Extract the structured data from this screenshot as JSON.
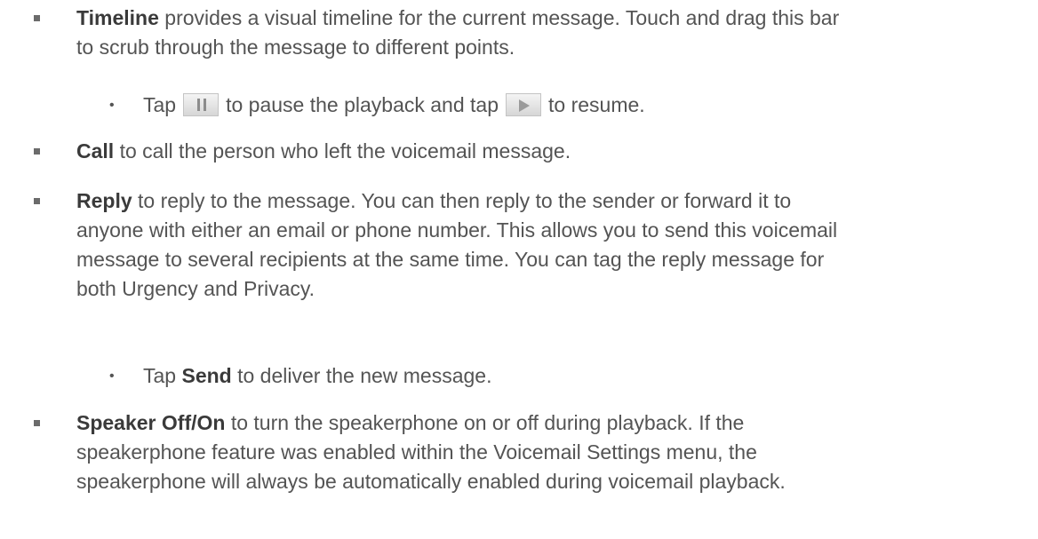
{
  "items": {
    "timeline": {
      "term": "Timeline",
      "text_line1": " provides a visual timeline for the current message. Touch and drag this bar",
      "text_line2": "to scrub through the message to different points.",
      "sub": {
        "text_before": "Tap",
        "pause_icon": "pause-button-icon",
        "text_middle": "to pause the playback and tap",
        "play_icon": "play-button-icon",
        "text_after": "to resume."
      }
    },
    "call": {
      "term": "Call",
      "text": " to call the person who left the voicemail message."
    },
    "reply": {
      "term": "Reply",
      "text_line1": " to reply to the message. You can then reply to the sender or forward it to",
      "text_line2": "anyone with either an email or phone number. This allows you to send this voicemail",
      "text_line3": "message to several recipients at the same time. You can tag the reply message for",
      "text_line4": "both Urgency and Privacy.",
      "sub": {
        "text_before": "Tap ",
        "term": "Send",
        "text_after": " to deliver the new message."
      }
    },
    "speaker": {
      "term": "Speaker Off/On",
      "text_line1": " to turn the speakerphone on or off during playback. If the",
      "text_line2": "speakerphone feature was enabled within the Voicemail Settings menu, the",
      "text_line3": "speakerphone will always be automatically enabled during voicemail playback."
    }
  }
}
